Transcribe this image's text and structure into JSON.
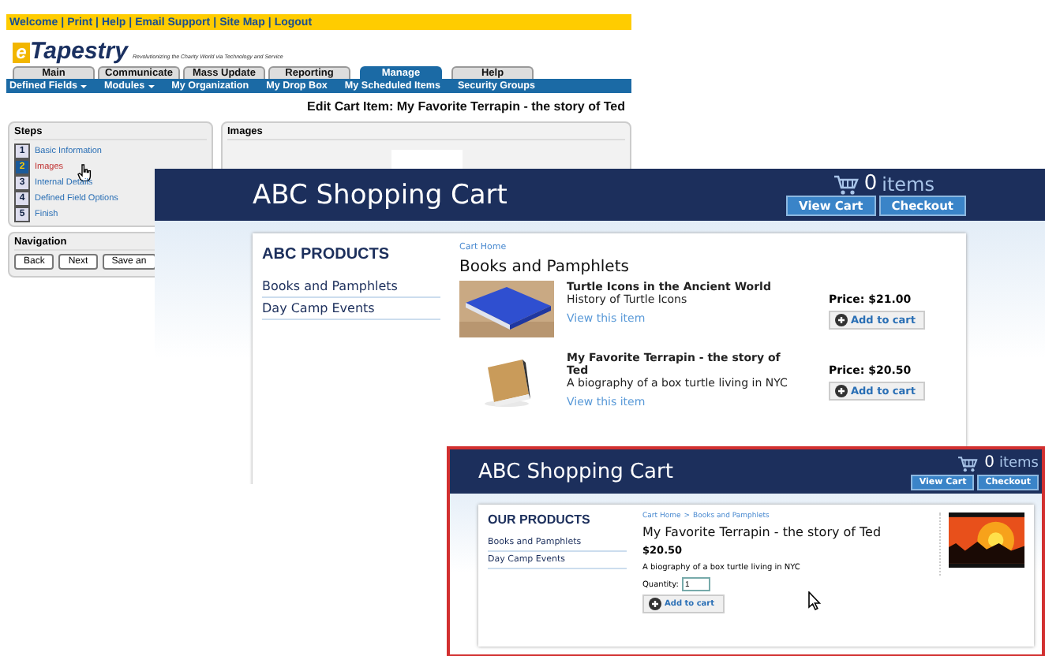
{
  "admin": {
    "top_link_separator": "|",
    "top_links": [
      "Welcome",
      "Print",
      "Help",
      "Email Support",
      "Site Map",
      "Logout"
    ],
    "logo": {
      "mark": "e",
      "brand": "Tapestry",
      "tagline": "Revolutionizing the Charity World via Technology and Service"
    },
    "tabs": [
      {
        "label": "Main",
        "selected": false
      },
      {
        "label": "Communicate",
        "selected": false
      },
      {
        "label": "Mass Update",
        "selected": false
      },
      {
        "label": "Reporting",
        "selected": false
      },
      {
        "label": "Manage",
        "selected": true
      },
      {
        "label": "Help",
        "selected": false
      }
    ],
    "subnav": [
      {
        "label": "Defined Fields",
        "dropdown": true
      },
      {
        "label": "Modules",
        "dropdown": true
      },
      {
        "label": "My Organization",
        "dropdown": false
      },
      {
        "label": "My Drop Box",
        "dropdown": false
      },
      {
        "label": "My Scheduled Items",
        "dropdown": false
      },
      {
        "label": "Security Groups",
        "dropdown": false
      }
    ],
    "page_title": "Edit Cart Item: My Favorite Terrapin - the story of Ted",
    "steps": {
      "title": "Steps",
      "items": [
        {
          "number": "1",
          "label": "Basic Information",
          "selected": false
        },
        {
          "number": "2",
          "label": "Images",
          "selected": true
        },
        {
          "number": "3",
          "label": "Internal Details",
          "selected": false
        },
        {
          "number": "4",
          "label": "Defined Field Options",
          "selected": false
        },
        {
          "number": "5",
          "label": "Finish",
          "selected": false
        }
      ]
    },
    "images_panel": {
      "title": "Images"
    },
    "navigation": {
      "title": "Navigation",
      "buttons": [
        "Back",
        "Next",
        "Save an"
      ]
    }
  },
  "cart_list": {
    "title": "ABC Shopping Cart",
    "cart_count": "0",
    "cart_unit": "items",
    "buttons": [
      "View Cart",
      "Checkout"
    ],
    "sidebar_title": "ABC PRODUCTS",
    "categories": [
      "Books and Pamphlets",
      "Day Camp Events"
    ],
    "breadcrumb": [
      "Cart Home"
    ],
    "heading": "Books and Pamphlets",
    "products": [
      {
        "title": "Turtle Icons in the Ancient World",
        "subtitle": "History of Turtle Icons",
        "link": "View this item",
        "price": "Price: $21.00",
        "button": "Add to cart"
      },
      {
        "title": "My Favorite Terrapin - the story of Ted",
        "subtitle": "A biography of a box turtle living in NYC",
        "link": "View this item",
        "price": "Price: $20.50",
        "button": "Add to cart"
      }
    ]
  },
  "cart_detail": {
    "title": "ABC Shopping Cart",
    "cart_count": "0",
    "cart_unit": "items",
    "buttons": [
      "View Cart",
      "Checkout"
    ],
    "sidebar_title": "OUR PRODUCTS",
    "categories": [
      "Books and Pamphlets",
      "Day Camp Events"
    ],
    "breadcrumb": [
      "Cart Home",
      "Books and Pamphlets"
    ],
    "breadcrumb_separator": ">",
    "heading": "My Favorite Terrapin - the story of Ted",
    "price": "$20.50",
    "description": "A biography of a box turtle living in NYC",
    "quantity_label": "Quantity:",
    "quantity": "1",
    "button": "Add to cart"
  }
}
